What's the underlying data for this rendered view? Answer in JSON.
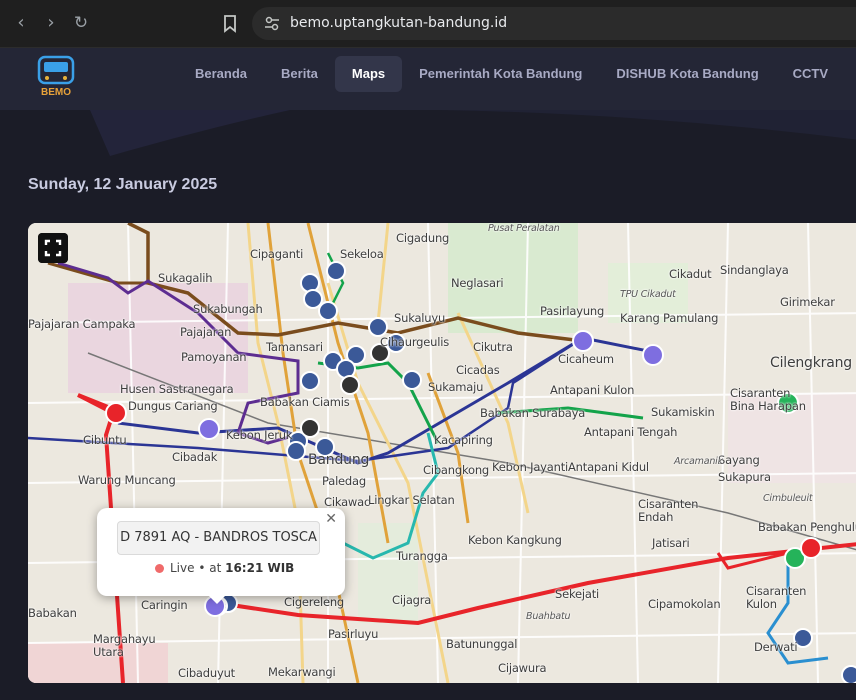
{
  "browser": {
    "url": "bemo.uptangkutan-bandung.id"
  },
  "site": {
    "logo_text": "BEMO",
    "menu": [
      {
        "label": "Beranda",
        "active": false
      },
      {
        "label": "Berita",
        "active": false
      },
      {
        "label": "Maps",
        "active": true
      },
      {
        "label": "Pemerintah Kota Bandung",
        "active": false
      },
      {
        "label": "DISHUB Kota Bandung",
        "active": false
      },
      {
        "label": "CCTV",
        "active": false
      }
    ]
  },
  "page": {
    "date": "Sunday, 12 January 2025"
  },
  "map": {
    "places": [
      {
        "name": "Sekeloa"
      },
      {
        "name": "Cigadung"
      },
      {
        "name": "Cipaganti"
      },
      {
        "name": "Sukagalih"
      },
      {
        "name": "Sukabungah"
      },
      {
        "name": "Pajajaran"
      },
      {
        "name": "Pamoyanan"
      },
      {
        "name": "Husen Sastranegara"
      },
      {
        "name": "Dungus Cariang"
      },
      {
        "name": "Cibuntu"
      },
      {
        "name": "Cibadak"
      },
      {
        "name": "Kebon Jeruk"
      },
      {
        "name": "Warung Muncang"
      },
      {
        "name": "Babakan Ciamis"
      },
      {
        "name": "Tamansari"
      },
      {
        "name": "Bandung"
      },
      {
        "name": "Paledag"
      },
      {
        "name": "Cikawao"
      },
      {
        "name": "Lingkar Selatan"
      },
      {
        "name": "Turangga"
      },
      {
        "name": "Cijagra"
      },
      {
        "name": "Cigereleng"
      },
      {
        "name": "Pasirluyu"
      },
      {
        "name": "Batununggal"
      },
      {
        "name": "Mekarwangi"
      },
      {
        "name": "Cijawura"
      },
      {
        "name": "Sekejati"
      },
      {
        "name": "Derwati"
      },
      {
        "name": "Cikutra"
      },
      {
        "name": "Cicadas"
      },
      {
        "name": "Sukamaju"
      },
      {
        "name": "Babakan Surabaya"
      },
      {
        "name": "Kacapiring"
      },
      {
        "name": "Cibangkong"
      },
      {
        "name": "Kebon Jayanti"
      },
      {
        "name": "Kebon Kangkung"
      },
      {
        "name": "Antapani Kulon"
      },
      {
        "name": "Antapani Tengah"
      },
      {
        "name": "Antapani Kidul"
      },
      {
        "name": "Sukamiskin"
      },
      {
        "name": "Pasirlayung"
      },
      {
        "name": "Cicaheum"
      },
      {
        "name": "Neglasari"
      },
      {
        "name": "Sukaluyu"
      },
      {
        "name": "Cikadut"
      },
      {
        "name": "Karang Pamulang"
      },
      {
        "name": "Sindanglaya"
      },
      {
        "name": "Girimekar"
      },
      {
        "name": "Cilengkrang"
      },
      {
        "name": "Cisaranten Bina Harapan"
      },
      {
        "name": "Cisaranten Kulon"
      },
      {
        "name": "Cisaranten Endah"
      },
      {
        "name": "Jatisari"
      },
      {
        "name": "Babakan Penghulu"
      },
      {
        "name": "Cipamokolan"
      },
      {
        "name": "Caringin"
      },
      {
        "name": "Babakan"
      },
      {
        "name": "Margahayu Utara"
      },
      {
        "name": "Cibaduyut"
      },
      {
        "name": "Sayang"
      },
      {
        "name": "Sukapura"
      },
      {
        "name": "Pajajaran Campaka"
      },
      {
        "name": "Cihaurgeulis"
      },
      {
        "name": "Pusat Peralatan"
      },
      {
        "name": "TPU Cikadut"
      },
      {
        "name": "Arcamanik"
      },
      {
        "name": "Cimbuleuit"
      },
      {
        "name": "Buahbatu"
      }
    ]
  },
  "popup": {
    "vehicle": "D 7891 AQ - BANDROS TOSCA",
    "status": "Live",
    "time_prefix": " • at ",
    "time": "16:21 WIB"
  },
  "colors": {
    "route_red": "#e8242a",
    "route_blue": "#2b3595",
    "route_brown": "#7a4c1d",
    "route_purple": "#5d2d91",
    "route_green": "#13a34a",
    "route_teal": "#28b8ae",
    "route_orange": "#e0a23a",
    "marker_blue": "#3b5998",
    "marker_purple": "#7e6ee0"
  }
}
